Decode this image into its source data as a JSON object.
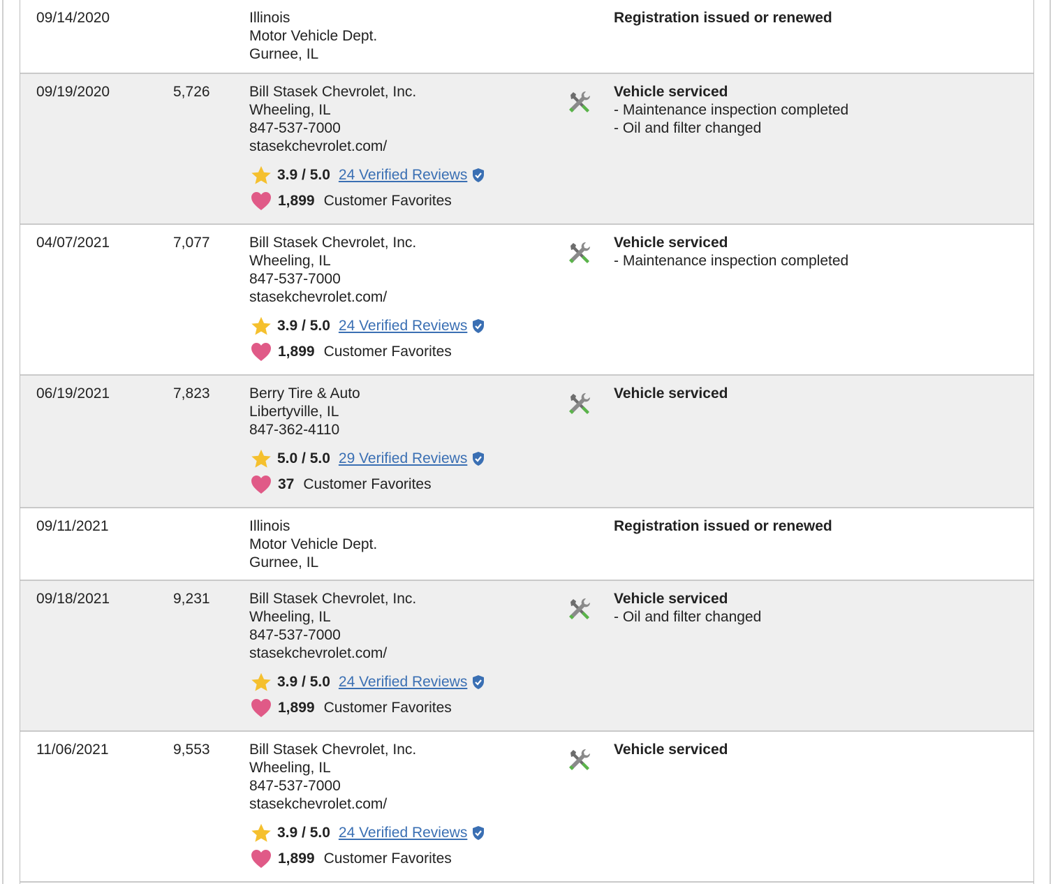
{
  "records": [
    {
      "date": "09/14/2020",
      "mileage": "",
      "source": [
        "Illinois",
        "Motor Vehicle Dept.",
        "Gurnee, IL"
      ],
      "title": "Registration issued or renewed",
      "details": []
    },
    {
      "date": "09/19/2020",
      "mileage": "5,726",
      "source": [
        "Bill Stasek Chevrolet, Inc.",
        "Wheeling, IL",
        "847-537-7000",
        "stasekchevrolet.com/"
      ],
      "rating": "3.9 / 5.0",
      "reviews": "24 Verified Reviews",
      "favorites_count": "1,899",
      "favorites_label": "Customer Favorites",
      "title": "Vehicle serviced",
      "details": [
        "- Maintenance inspection completed",
        "- Oil and filter changed"
      ]
    },
    {
      "date": "04/07/2021",
      "mileage": "7,077",
      "source": [
        "Bill Stasek Chevrolet, Inc.",
        "Wheeling, IL",
        "847-537-7000",
        "stasekchevrolet.com/"
      ],
      "rating": "3.9 / 5.0",
      "reviews": "24 Verified Reviews",
      "favorites_count": "1,899",
      "favorites_label": "Customer Favorites",
      "title": "Vehicle serviced",
      "details": [
        "- Maintenance inspection completed"
      ]
    },
    {
      "date": "06/19/2021",
      "mileage": "7,823",
      "source": [
        "Berry Tire & Auto",
        "Libertyville, IL",
        "847-362-4110"
      ],
      "rating": "5.0 / 5.0",
      "reviews": "29 Verified Reviews",
      "favorites_count": "37",
      "favorites_label": "Customer Favorites",
      "title": "Vehicle serviced",
      "details": []
    },
    {
      "date": "09/11/2021",
      "mileage": "",
      "source": [
        "Illinois",
        "Motor Vehicle Dept.",
        "Gurnee, IL"
      ],
      "title": "Registration issued or renewed",
      "details": []
    },
    {
      "date": "09/18/2021",
      "mileage": "9,231",
      "source": [
        "Bill Stasek Chevrolet, Inc.",
        "Wheeling, IL",
        "847-537-7000",
        "stasekchevrolet.com/"
      ],
      "rating": "3.9 / 5.0",
      "reviews": "24 Verified Reviews",
      "favorites_count": "1,899",
      "favorites_label": "Customer Favorites",
      "title": "Vehicle serviced",
      "details": [
        "- Oil and filter changed"
      ]
    },
    {
      "date": "11/06/2021",
      "mileage": "9,553",
      "source": [
        "Bill Stasek Chevrolet, Inc.",
        "Wheeling, IL",
        "847-537-7000",
        "stasekchevrolet.com/"
      ],
      "rating": "3.9 / 5.0",
      "reviews": "24 Verified Reviews",
      "favorites_count": "1,899",
      "favorites_label": "Customer Favorites",
      "title": "Vehicle serviced",
      "details": []
    }
  ],
  "icons": {
    "service": "wrench-screwdriver-icon",
    "rating": "star-icon",
    "verified": "shield-check-icon",
    "favorites": "heart-icon"
  },
  "colors": {
    "shaded_row": "#efefef",
    "link": "#3a6fb3",
    "star": "#f5c02e",
    "heart": "#e05a87",
    "verified": "#3a6fb3"
  }
}
